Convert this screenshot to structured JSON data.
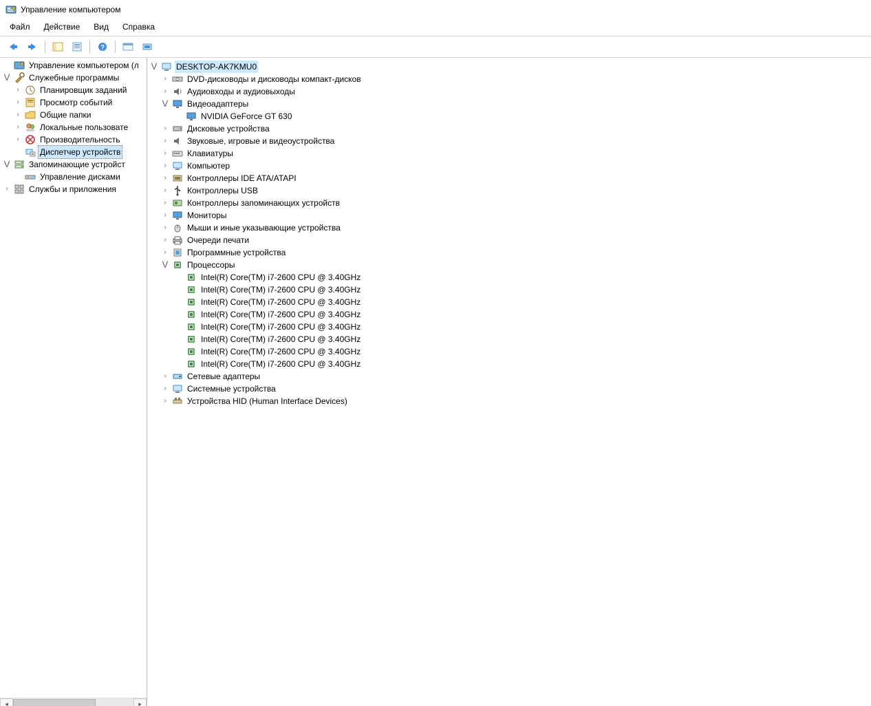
{
  "window": {
    "title": "Управление компьютером"
  },
  "menu": {
    "file": "Файл",
    "action": "Действие",
    "view": "Вид",
    "help": "Справка"
  },
  "left_tree": {
    "root": "Управление компьютером (л",
    "system_tools": "Служебные программы",
    "task_scheduler": "Планировщик заданий",
    "event_viewer": "Просмотр событий",
    "shared_folders": "Общие папки",
    "local_users": "Локальные пользовате",
    "performance": "Производительность",
    "device_manager": "Диспетчер устройств",
    "storage": "Запоминающие устройст",
    "disk_mgmt": "Управление дисками",
    "services_apps": "Службы и приложения"
  },
  "right_tree": {
    "root": "DESKTOP-AK7KMU0",
    "dvd": "DVD-дисководы и дисководы компакт-дисков",
    "audio": "Аудиовходы и аудиовыходы",
    "video": "Видеоадаптеры",
    "video_card": "NVIDIA GeForce GT 630",
    "disk": "Дисковые устройства",
    "sound": "Звуковые, игровые и видеоустройства",
    "keyboard": "Клавиатуры",
    "computer": "Компьютер",
    "ide": "Контроллеры IDE ATA/ATAPI",
    "usb": "Контроллеры USB",
    "storage_ctrl": "Контроллеры запоминающих устройств",
    "monitors": "Мониторы",
    "mice": "Мыши и иные указывающие устройства",
    "print": "Очереди печати",
    "software": "Программные устройства",
    "processors": "Процессоры",
    "cpu": "Intel(R) Core(TM) i7-2600 CPU @ 3.40GHz",
    "network": "Сетевые адаптеры",
    "system": "Системные устройства",
    "hid": "Устройства HID (Human Interface Devices)"
  }
}
